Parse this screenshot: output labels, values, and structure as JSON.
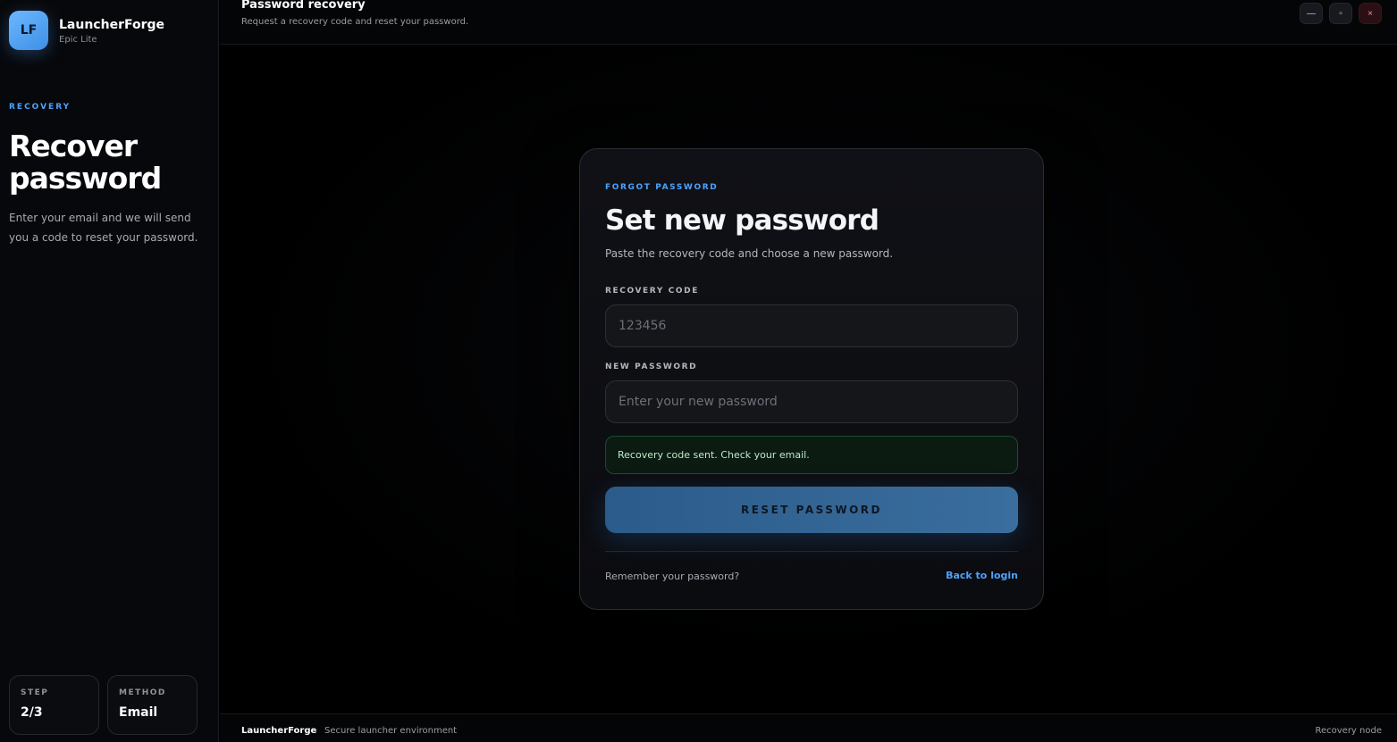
{
  "brand": {
    "logo_text": "LF",
    "name": "LauncherForge",
    "subtitle": "Epic Lite"
  },
  "sidebar": {
    "eyebrow": "RECOVERY",
    "title": "Recover password",
    "description": "Enter your email and we will send you a code to reset your password.",
    "stats": [
      {
        "label": "STEP",
        "value": "2/3"
      },
      {
        "label": "METHOD",
        "value": "Email"
      }
    ]
  },
  "topbar": {
    "title": "Password recovery",
    "subtitle": "Request a recovery code and reset your password.",
    "min_glyph": "—",
    "max_glyph": "▫",
    "close_glyph": "×"
  },
  "card": {
    "eyebrow": "FORGOT PASSWORD",
    "title": "Set new password",
    "subtitle": "Paste the recovery code and choose a new password.",
    "recovery_code_label": "RECOVERY CODE",
    "recovery_code_placeholder": "123456",
    "new_password_label": "NEW PASSWORD",
    "new_password_placeholder": "Enter your new password",
    "notice": "Recovery code sent. Check your email.",
    "submit_label": "RESET PASSWORD",
    "remember_text": "Remember your password?",
    "back_link": "Back to login"
  },
  "footer": {
    "brand": "LauncherForge",
    "environment": "Secure launcher environment",
    "node": "Recovery node"
  },
  "colors": {
    "accent": "#4aa3ff",
    "success_bg": "#0b1b12",
    "button": "#2b5b8a"
  }
}
